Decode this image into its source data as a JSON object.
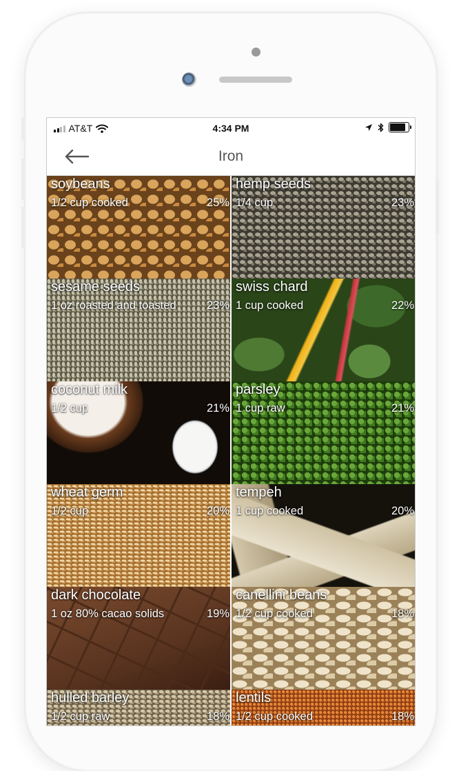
{
  "status_bar": {
    "carrier": "AT&T",
    "time": "4:34 PM"
  },
  "nav": {
    "title": "Iron"
  },
  "foods": [
    {
      "name": "soybeans",
      "serving": "1/2 cup cooked",
      "percent": "25%",
      "image": "soybeans"
    },
    {
      "name": "hemp seeds",
      "serving": "1/4 cup",
      "percent": "23%",
      "image": "hemp"
    },
    {
      "name": "sesame seeds",
      "serving": "1 oz roasted and toasted",
      "percent": "23%",
      "image": "sesame"
    },
    {
      "name": "swiss chard",
      "serving": "1 cup cooked",
      "percent": "22%",
      "image": "chard"
    },
    {
      "name": "coconut milk",
      "serving": "1/2 cup",
      "percent": "21%",
      "image": "coconut"
    },
    {
      "name": "parsley",
      "serving": "1 cup raw",
      "percent": "21%",
      "image": "parsley"
    },
    {
      "name": "wheat germ",
      "serving": "1/2 cup",
      "percent": "20%",
      "image": "wheat"
    },
    {
      "name": "tempeh",
      "serving": "1 cup cooked",
      "percent": "20%",
      "image": "tempeh"
    },
    {
      "name": "dark chocolate",
      "serving": "1 oz 80% cacao solids",
      "percent": "19%",
      "image": "chocolate"
    },
    {
      "name": "canellini beans",
      "serving": "1/2 cup cooked",
      "percent": "18%",
      "image": "canellini"
    },
    {
      "name": "hulled barley",
      "serving": "1/2 cup raw",
      "percent": "18%",
      "image": "barley"
    },
    {
      "name": "lentils",
      "serving": "1/2 cup cooked",
      "percent": "18%",
      "image": "lentils"
    }
  ]
}
